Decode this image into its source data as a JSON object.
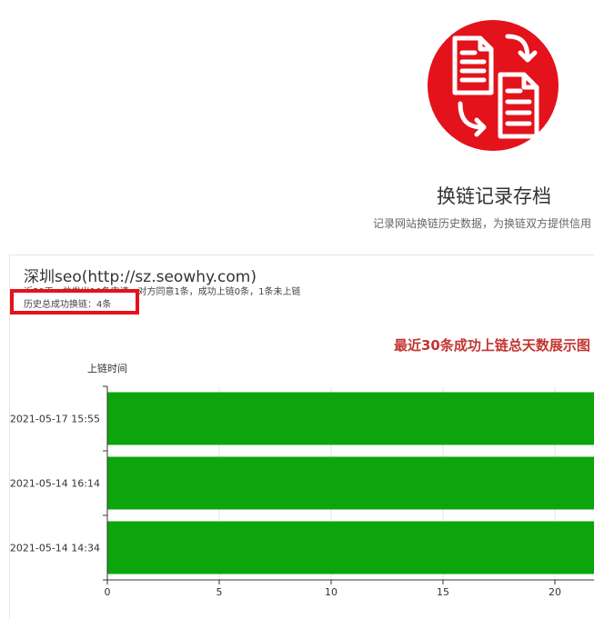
{
  "header": {
    "logo_icon": "document-exchange-icon",
    "title": "换链记录存档",
    "subtitle": "记录网站换链历史数据，为换链双方提供信用"
  },
  "site": {
    "name": "深圳seo(http://sz.seowhy.com)",
    "stats": "近30天，共发出10条申请，对方同意1条，成功上链0条，1条未上链",
    "total": "历史总成功换链：4条"
  },
  "colors": {
    "accent": "#e3121b",
    "bar": "#0ca60c",
    "chart_title": "#c23531"
  },
  "chart_data": {
    "type": "bar",
    "orientation": "horizontal",
    "title": "最近30条成功上链总天数展示图",
    "ylabel": "上链时间",
    "xlabel": "",
    "categories": [
      "2021-05-17 15:55",
      "2021-05-14 16:14",
      "2021-05-14 14:34"
    ],
    "values": [
      23,
      23,
      23
    ],
    "xlim": [
      0,
      25
    ],
    "xticks": [
      0,
      5,
      10,
      15,
      20
    ],
    "grid": true
  }
}
